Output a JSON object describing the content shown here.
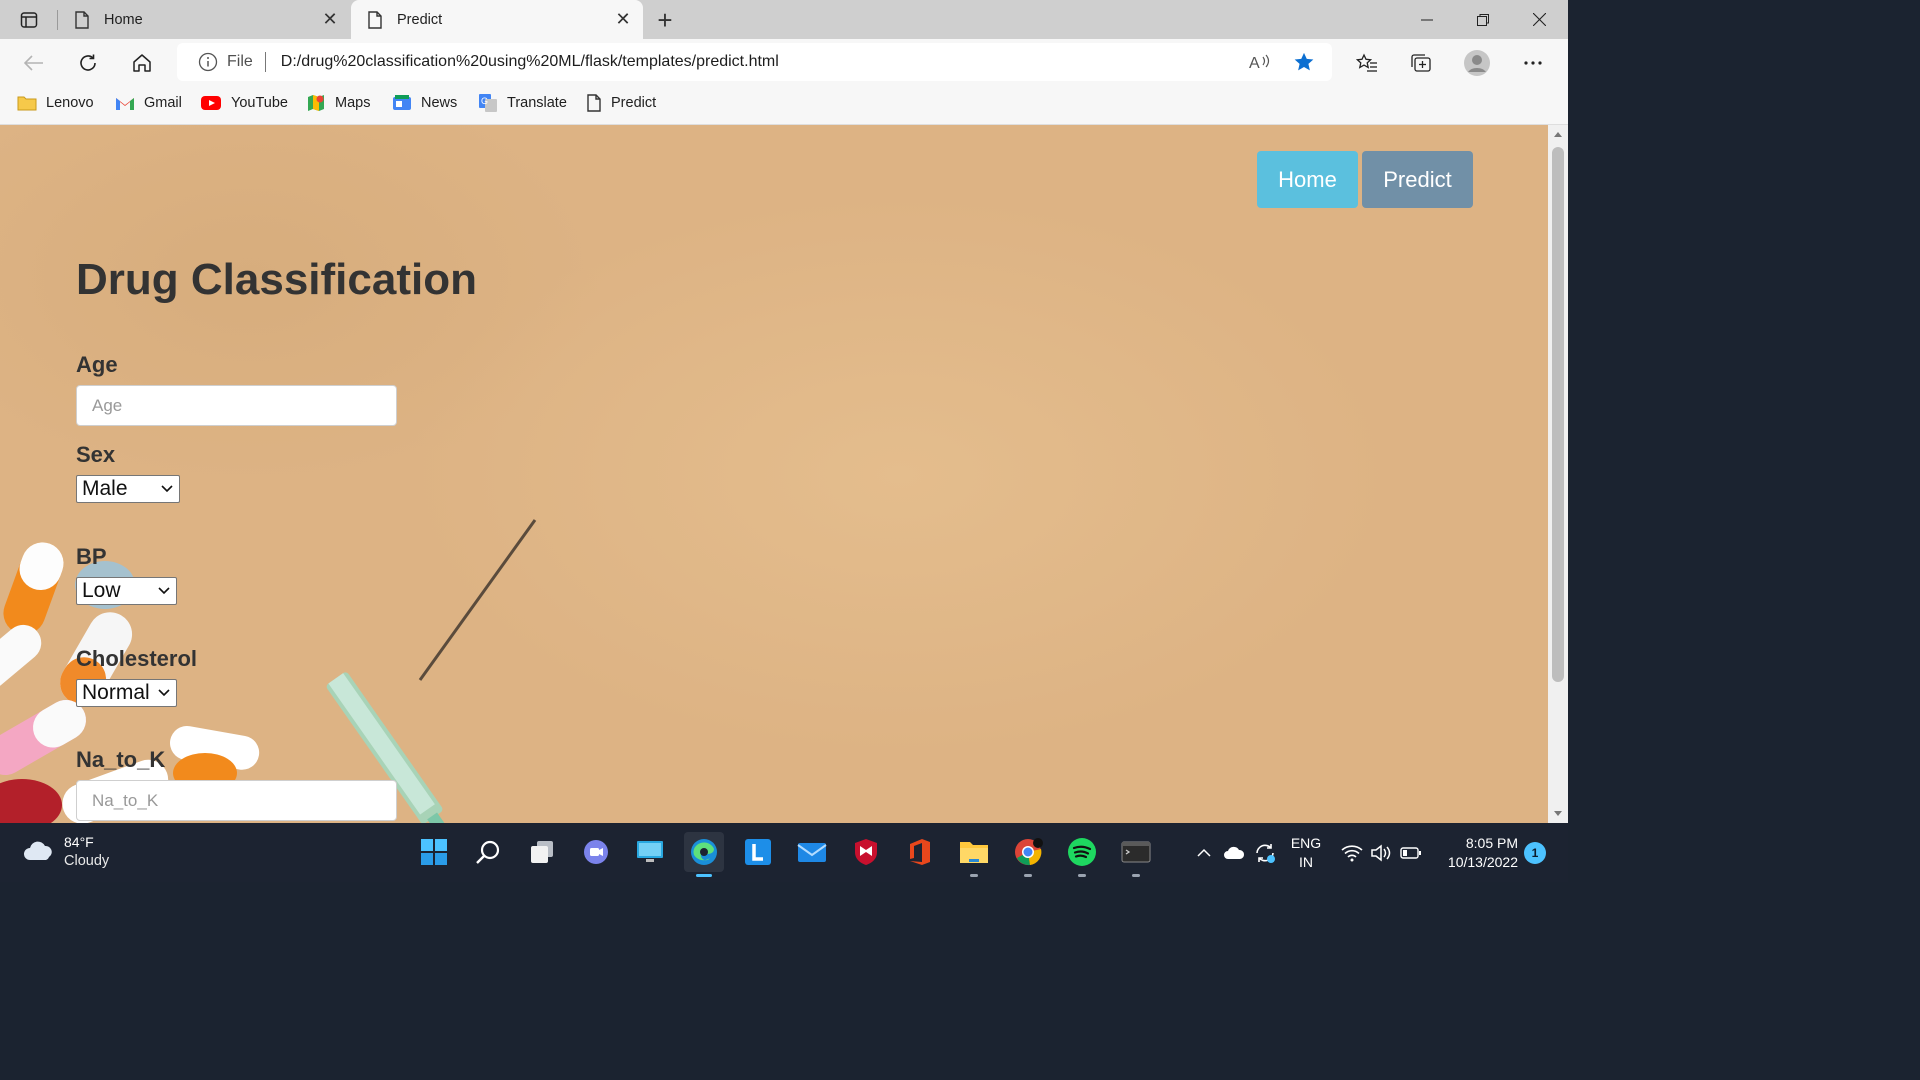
{
  "browser": {
    "tabs": [
      {
        "title": "Home",
        "active": false
      },
      {
        "title": "Predict",
        "active": true
      }
    ],
    "address": {
      "scheme_label": "File",
      "url": "D:/drug%20classification%20using%20ML/flask/templates/predict.html"
    },
    "bookmarks": [
      "Lenovo",
      "Gmail",
      "YouTube",
      "Maps",
      "News",
      "Translate",
      "Predict"
    ]
  },
  "page": {
    "nav": {
      "home": "Home",
      "predict": "Predict"
    },
    "title": "Drug Classification",
    "form": {
      "age": {
        "label": "Age",
        "placeholder": "Age"
      },
      "sex": {
        "label": "Sex",
        "selected": "Male"
      },
      "bp": {
        "label": "BP",
        "selected": "Low"
      },
      "cholesterol": {
        "label": "Cholesterol",
        "selected": "Normal"
      },
      "na_to_k": {
        "label": "Na_to_K",
        "placeholder": "Na_to_K"
      }
    }
  },
  "taskbar": {
    "weather": {
      "temp": "84°F",
      "condition": "Cloudy"
    },
    "language": {
      "line1": "ENG",
      "line2": "IN"
    },
    "clock": {
      "time": "8:05 PM",
      "date": "10/13/2022"
    },
    "notifications": "1"
  },
  "colors": {
    "accent": "#0078d4",
    "home_button": "#5bc0de",
    "predict_button": "#7190a7",
    "page_bg": "#ddb384"
  }
}
